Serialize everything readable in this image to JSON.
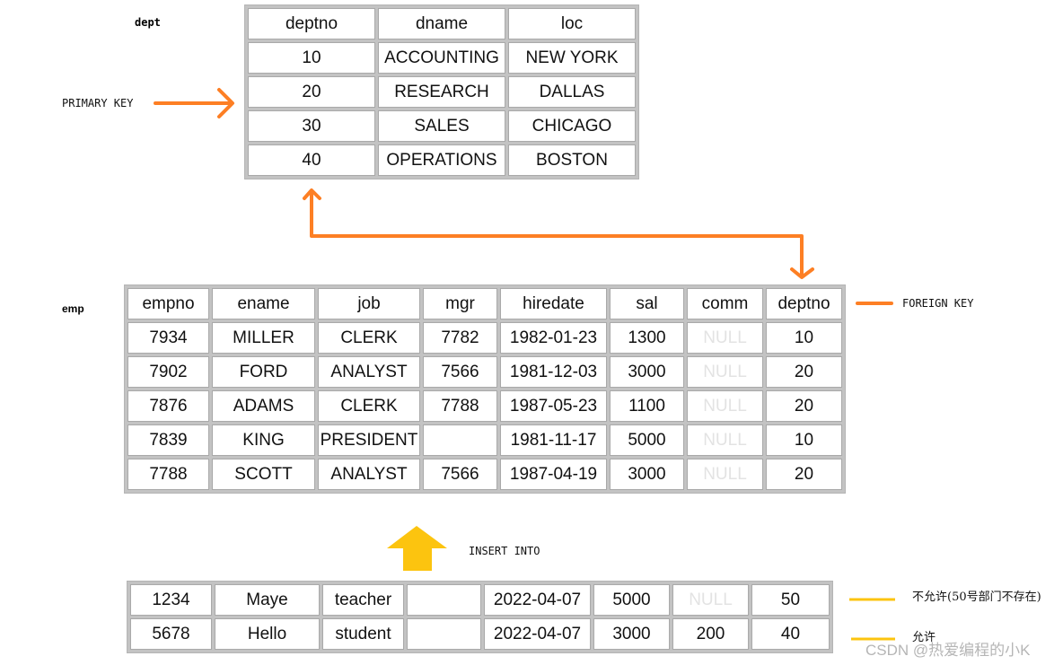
{
  "colors": {
    "arrow_orange": "#fd7f24",
    "arrow_yellow": "#fcc40f",
    "grid_border": "#c3c3c3",
    "null_text": "#e3e3e3"
  },
  "labels": {
    "dept_table": "dept",
    "emp_table": "emp",
    "primary_key": "PRIMARY KEY",
    "foreign_key": "FOREIGN KEY",
    "insert_into": "INSERT INTO",
    "note_rejected": "不允许(50号部门不存在)",
    "note_allowed": "允许",
    "watermark": "CSDN @热爱编程的小K"
  },
  "icons": {
    "primary_key_arrow": "arrow-right-icon",
    "fk_link_arrow": "double-ended-elbow-arrow-icon",
    "insert_arrow": "block-arrow-up-icon"
  },
  "dept": {
    "columns": [
      "deptno",
      "dname",
      "loc"
    ],
    "rows": [
      [
        "10",
        "ACCOUNTING",
        "NEW YORK"
      ],
      [
        "20",
        "RESEARCH",
        "DALLAS"
      ],
      [
        "30",
        "SALES",
        "CHICAGO"
      ],
      [
        "40",
        "OPERATIONS",
        "BOSTON"
      ]
    ]
  },
  "emp": {
    "columns": [
      "empno",
      "ename",
      "job",
      "mgr",
      "hiredate",
      "sal",
      "comm",
      "deptno"
    ],
    "rows": [
      [
        "7934",
        "MILLER",
        "CLERK",
        "7782",
        "1982-01-23",
        "1300",
        "NULL",
        "10"
      ],
      [
        "7902",
        "FORD",
        "ANALYST",
        "7566",
        "1981-12-03",
        "3000",
        "NULL",
        "20"
      ],
      [
        "7876",
        "ADAMS",
        "CLERK",
        "7788",
        "1987-05-23",
        "1100",
        "NULL",
        "20"
      ],
      [
        "7839",
        "KING",
        "PRESIDENT",
        "",
        "1981-11-17",
        "5000",
        "NULL",
        "10"
      ],
      [
        "7788",
        "SCOTT",
        "ANALYST",
        "7566",
        "1987-04-19",
        "3000",
        "NULL",
        "20"
      ]
    ]
  },
  "insert": {
    "rows": [
      [
        "1234",
        "Maye",
        "teacher",
        "",
        "2022-04-07",
        "5000",
        "NULL",
        "50"
      ],
      [
        "5678",
        "Hello",
        "student",
        "",
        "2022-04-07",
        "3000",
        "200",
        "40"
      ]
    ]
  }
}
